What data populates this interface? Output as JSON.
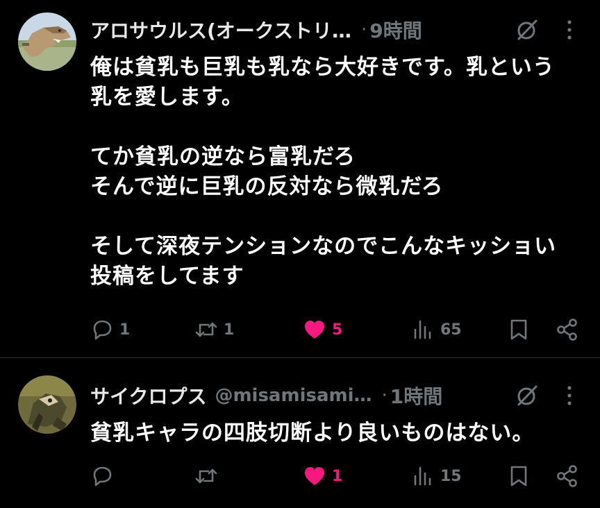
{
  "colors": {
    "background": "#000000",
    "text_primary": "#ffffff",
    "text_secondary": "#71767b",
    "like_pink": "#f91880",
    "divider": "#2f3336"
  },
  "posts": [
    {
      "display_name": "アロサウルス(オークストリ…",
      "handle": "",
      "dot": "·",
      "time": "9時間",
      "text": "俺は貧乳も巨乳も乳なら大好きです。乳という\n乳を愛します。\n\nてか貧乳の逆なら富乳だろ\nそんで逆に巨乳の反対なら微乳だろ\n\nそして深夜テンションなのでこんなキッショい\n投稿をしてます",
      "avatar_icon": "dinosaur-avatar",
      "actions": {
        "reply_count": "1",
        "repost_count": "1",
        "like_count": "5",
        "liked": true,
        "views_count": "65"
      }
    },
    {
      "display_name": "サイクロプス",
      "handle": "@misamisami…",
      "dot": "·",
      "time": "1時間",
      "text": "貧乳キャラの四肢切断より良いものはない。",
      "avatar_icon": "creature-avatar",
      "actions": {
        "reply_count": "",
        "repost_count": "",
        "like_count": "1",
        "liked": true,
        "views_count": "15"
      }
    }
  ],
  "icons": {
    "reply": "reply-icon",
    "repost": "repost-icon",
    "like": "heart-icon",
    "views": "views-icon",
    "bookmark": "bookmark-icon",
    "share": "share-icon",
    "grok": "grok-icon",
    "more": "more-icon"
  }
}
